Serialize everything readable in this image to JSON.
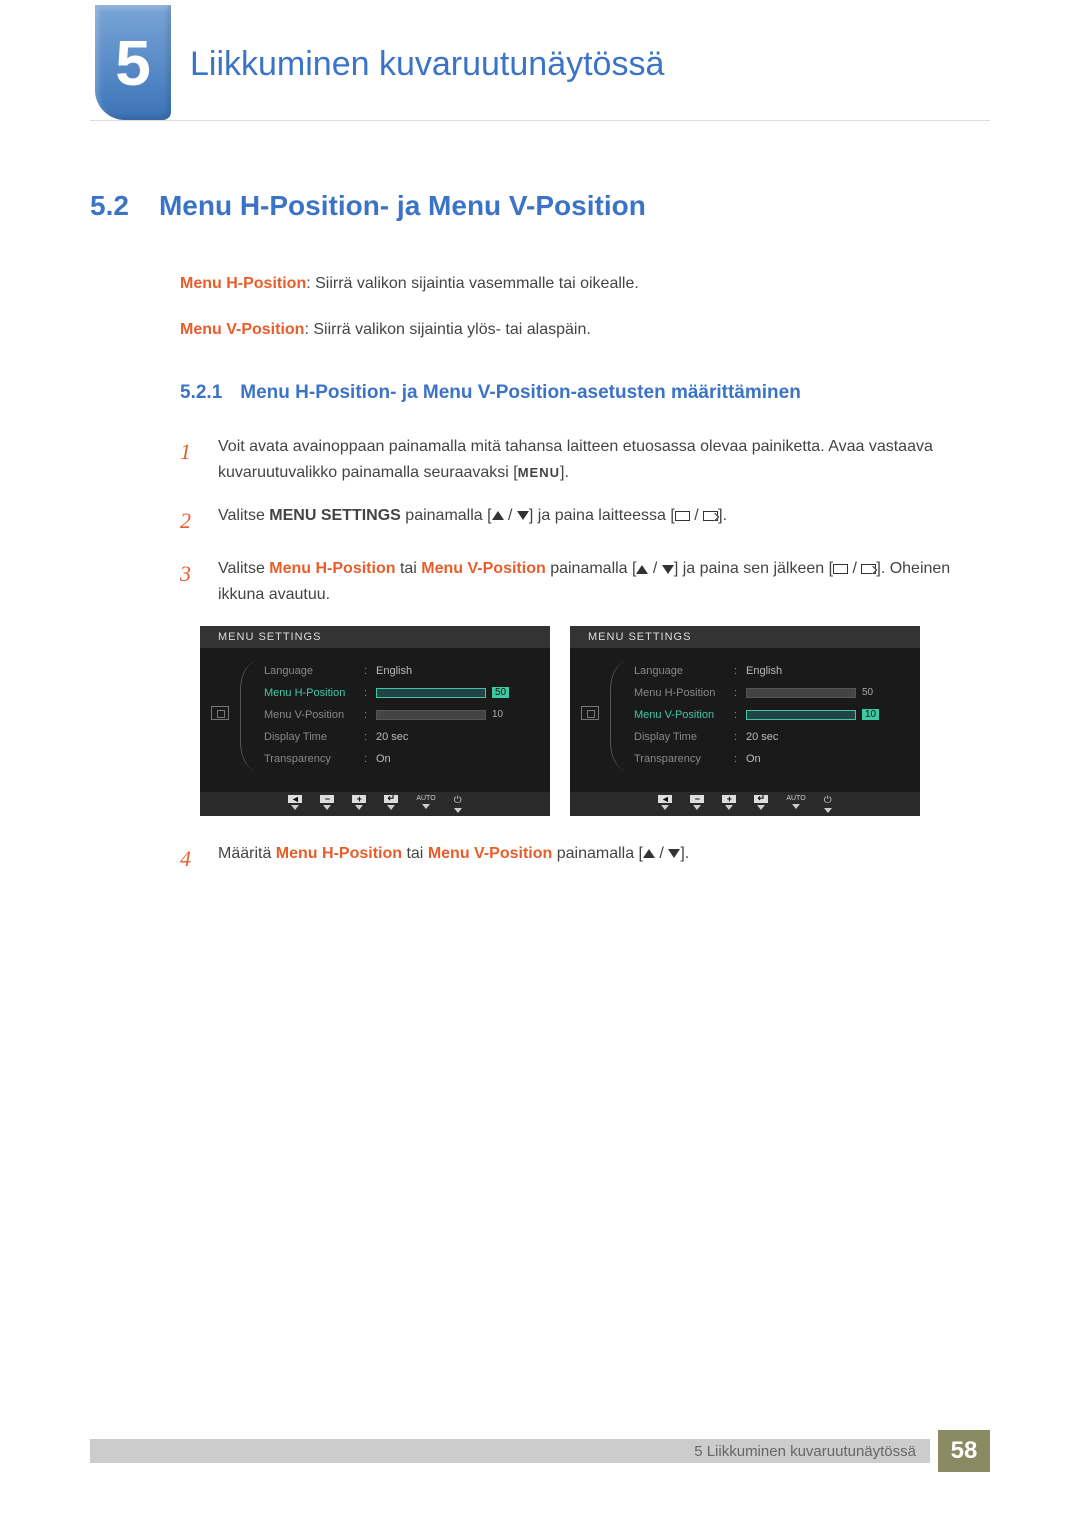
{
  "chapter": {
    "num": "5",
    "title": "Liikkuminen kuvaruutunäytössä"
  },
  "section": {
    "num": "5.2",
    "title": "Menu H-Position- ja Menu V-Position"
  },
  "desc": {
    "hpos_term": "Menu H-Position",
    "hpos_text": ": Siirrä valikon sijaintia vasemmalle tai oikealle.",
    "vpos_term": "Menu V-Position",
    "vpos_text": ": Siirrä valikon sijaintia ylös- tai alaspäin."
  },
  "subsection": {
    "num": "5.2.1",
    "title": "Menu H-Position- ja Menu V-Position-asetusten määrittäminen"
  },
  "steps": {
    "s1": "Voit avata avainoppaan painamalla mitä tahansa laitteen etuosassa olevaa painiketta. Avaa vastaava kuvaruutuvalikko painamalla seuraavaksi [",
    "s1_menu": "MENU",
    "s1_end": "].",
    "s2a": "Valitse ",
    "s2_term": "MENU SETTINGS",
    "s2b": " painamalla [",
    "s2c": "] ja paina laitteessa [",
    "s2d": "].",
    "s3a": "Valitse ",
    "s3_term1": "Menu H-Position",
    "s3b": " tai ",
    "s3_term2": "Menu V-Position",
    "s3c": " painamalla [",
    "s3d": "] ja paina sen jälkeen [",
    "s3e": "]. Oheinen ikkuna avautuu.",
    "s4a": "Määritä ",
    "s4_term1": "Menu H-Position",
    "s4b": " tai ",
    "s4_term2": "Menu V-Position",
    "s4c": " painamalla [",
    "s4d": "]."
  },
  "osd": {
    "header": "MENU SETTINGS",
    "items": {
      "language": "Language",
      "hpos": "Menu H-Position",
      "vpos": "Menu V-Position",
      "dtime": "Display Time",
      "transp": "Transparency"
    },
    "vals": {
      "language": "English",
      "hpos": "50",
      "vpos": "10",
      "dtime": "20 sec",
      "transp": "On"
    },
    "footer_auto": "AUTO"
  },
  "footer": {
    "text": "5 Liikkuminen kuvaruutunäytössä",
    "page": "58"
  }
}
